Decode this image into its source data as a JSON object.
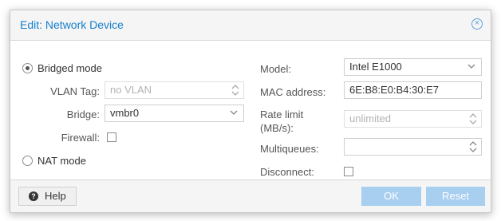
{
  "dialog": {
    "title": "Edit: Network Device"
  },
  "left": {
    "bridged_mode": {
      "label": "Bridged mode",
      "checked": true
    },
    "vlan_tag": {
      "label": "VLAN Tag:",
      "placeholder": "no VLAN",
      "disabled": true
    },
    "bridge": {
      "label": "Bridge:",
      "value": "vmbr0"
    },
    "firewall": {
      "label": "Firewall:",
      "checked": false
    },
    "nat_mode": {
      "label": "NAT mode",
      "checked": false
    }
  },
  "right": {
    "model": {
      "label": "Model:",
      "value": "Intel E1000"
    },
    "mac": {
      "label": "MAC address:",
      "value": "6E:B8:E0:B4:30:E7"
    },
    "rate_limit": {
      "label_line1": "Rate limit",
      "label_line2": "(MB/s):",
      "placeholder": "unlimited",
      "disabled": true
    },
    "multiqueues": {
      "label": "Multiqueues:",
      "value": ""
    },
    "disconnect": {
      "label": "Disconnect:",
      "checked": false
    }
  },
  "footer": {
    "help_label": "Help",
    "ok_label": "OK",
    "reset_label": "Reset"
  },
  "colors": {
    "accent": "#157fcc",
    "button_disabled": "#a8cef0",
    "icon": "#5fa2dd"
  },
  "icons": {
    "close": "close-circle-icon",
    "help": "question-circle-icon"
  }
}
